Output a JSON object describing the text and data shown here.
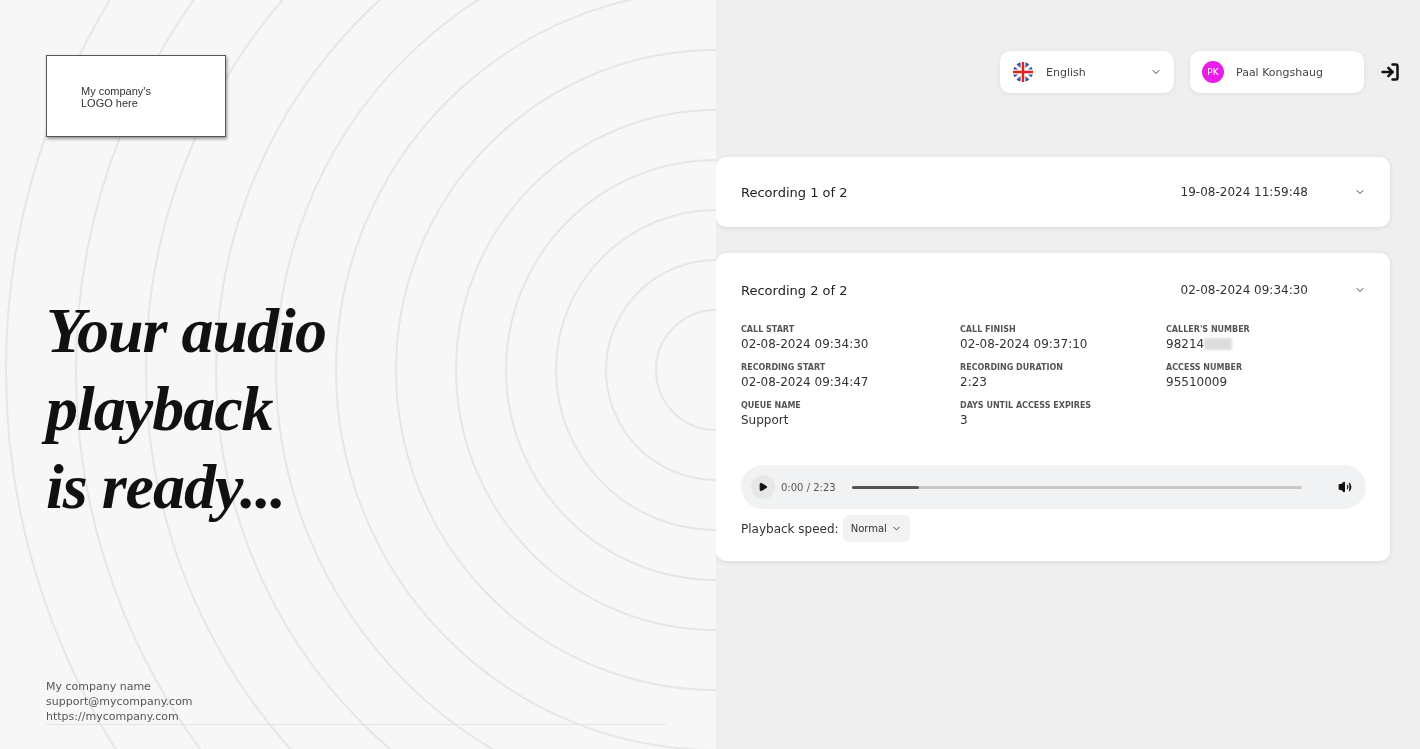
{
  "logo": {
    "text": "My company's\nLOGO here"
  },
  "headline": [
    "Your audio",
    "playback",
    "is ready..."
  ],
  "footer": [
    "My company name",
    "support@mycompany.com",
    "https://mycompany.com"
  ],
  "language": {
    "label": "English"
  },
  "user": {
    "initials": "PK",
    "name": "Paal Kongshaug",
    "color": "#e81ee8"
  },
  "recordings": [
    {
      "title": "Recording 1 of 2",
      "date": "19-08-2024 11:59:48",
      "expanded": false
    },
    {
      "title": "Recording 2 of 2",
      "date": "02-08-2024 09:34:30",
      "expanded": true,
      "fields": [
        {
          "label": "CALL START",
          "value": "02-08-2024 09:34:30",
          "blurred": false
        },
        {
          "label": "CALL FINISH",
          "value": "02-08-2024 09:37:10",
          "blurred": false
        },
        {
          "label": "CALLER'S NUMBER",
          "value": "98214",
          "blurred": true
        },
        {
          "label": "RECORDING START",
          "value": "02-08-2024 09:34:47",
          "blurred": false
        },
        {
          "label": "RECORDING DURATION",
          "value": "2:23",
          "blurred": false
        },
        {
          "label": "ACCESS NUMBER",
          "value": "95510009",
          "blurred": false
        },
        {
          "label": "QUEUE NAME",
          "value": "Support",
          "blurred": false
        },
        {
          "label": "DAYS UNTIL ACCESS EXPIRES",
          "value": "3",
          "blurred": false
        }
      ],
      "player": {
        "time": "0:00 / 2:23",
        "level": 0.15
      },
      "speed": {
        "label": "Playback speed:",
        "value": "Normal"
      }
    }
  ]
}
